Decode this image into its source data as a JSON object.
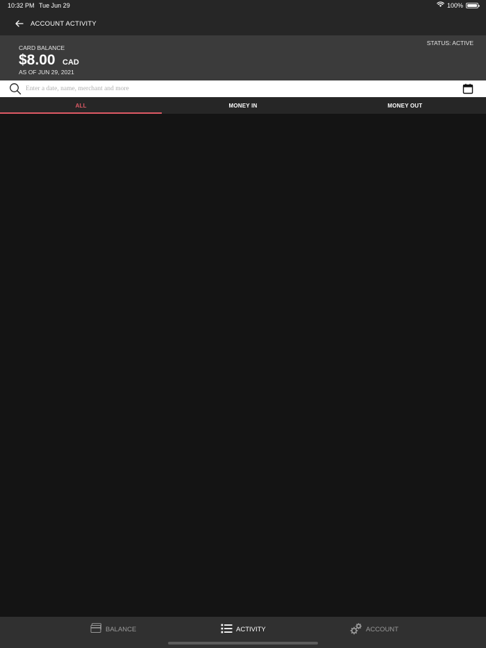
{
  "status_bar": {
    "time": "10:32 PM",
    "date": "Tue Jun 29",
    "battery": "100%",
    "battery_level": 1.0
  },
  "nav": {
    "title": "ACCOUNT ACTIVITY",
    "back_icon": "arrow-left-icon"
  },
  "card": {
    "label": "CARD BALANCE",
    "amount": "$8.00",
    "currency": "CAD",
    "as_of": "AS OF JUN 29, 2021",
    "status": "STATUS: ACTIVE"
  },
  "search": {
    "value": "",
    "placeholder": "Enter a date, name, merchant and more",
    "icon": "search-icon",
    "calendar_icon": "calendar-icon"
  },
  "tabs": [
    {
      "label": "ALL",
      "active": true
    },
    {
      "label": "MONEY IN",
      "active": false
    },
    {
      "label": "MONEY OUT",
      "active": false
    }
  ],
  "bottom_nav": [
    {
      "label": "BALANCE",
      "icon": "card-icon",
      "active": false
    },
    {
      "label": "ACTIVITY",
      "icon": "list-icon",
      "active": true
    },
    {
      "label": "ACCOUNT",
      "icon": "gears-icon",
      "active": false
    }
  ],
  "colors": {
    "accent": "#e05a66",
    "background": "#141414",
    "header": "#262626",
    "card": "#3b3b3b",
    "bottom_bar": "#303030"
  }
}
